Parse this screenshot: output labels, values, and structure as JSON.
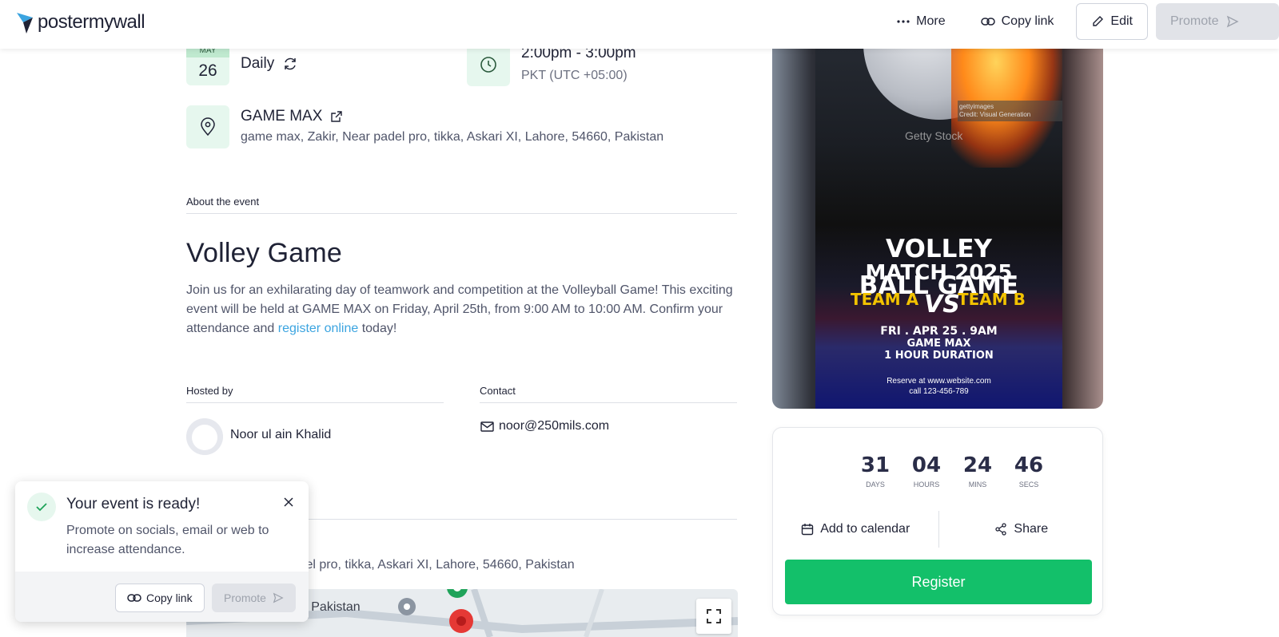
{
  "header": {
    "brand": "postermywall",
    "more_label": "More",
    "copy_link_label": "Copy link",
    "edit_label": "Edit",
    "promote_label": "Promote"
  },
  "event": {
    "month": "MAY",
    "day": "26",
    "recurrence": "Daily",
    "time": "2:00pm - 3:00pm",
    "timezone": "PKT (UTC +05:00)",
    "venue_name": "GAME MAX",
    "venue_address": "game max, Zakir, Near padel pro, tikka, Askari XI, Lahore, 54660, Pakistan",
    "about_label": "About the event",
    "title": "Volley Game",
    "description_pre": "Join us for an exhilarating day of teamwork and competition at the Volleyball Game! This exciting event will be held at GAME MAX on Friday, April 25th, from 9:00 AM to 10:00 AM. Confirm your attendance and ",
    "description_link": "register online",
    "description_post": " today!"
  },
  "host": {
    "label": "Hosted by",
    "name": "Noor ul ain Khalid"
  },
  "contact": {
    "label": "Contact",
    "email": "noor@250mils.com"
  },
  "location": {
    "address_partial": "r padel pro, tikka, Askari XI, Lahore, 54660, Pakistan",
    "map_label": "del IN Pakistan"
  },
  "toast": {
    "title": "Your event is ready!",
    "body": "Promote on socials, email or web to increase attendance.",
    "copy_link_label": "Copy link",
    "promote_label": "Promote"
  },
  "poster": {
    "getty_line1": "gettyimages",
    "getty_line2": "Credit: Visual Generation",
    "getty_mark": "Getty Stock",
    "line1": "VOLLEY",
    "line2": "MATCH 2025",
    "line3": "BALL GAME",
    "team_a": "TEAM A",
    "team_b": "TEAM B",
    "vs": "VS",
    "date": "FRI . APR 25 . 9AM",
    "venue": "GAME MAX",
    "duration": "1 HOUR DURATION",
    "reserve": "Reserve at www.website.com",
    "call": "call 123-456-789"
  },
  "countdown": {
    "days": "31",
    "days_label": "DAYS",
    "hours": "04",
    "hours_label": "HOURS",
    "mins": "24",
    "mins_label": "MINS",
    "secs": "46",
    "secs_label": "SECS"
  },
  "card": {
    "add_calendar_label": "Add to calendar",
    "share_label": "Share",
    "register_label": "Register"
  },
  "colors": {
    "accent_green": "#13c06a",
    "badge_green": "#e6f7ee",
    "link_blue": "#3ba4e0",
    "text_dark": "#1f2235"
  },
  "icons": [
    "logo-mark",
    "more-dots-icon",
    "link-icon",
    "pencil-icon",
    "send-icon",
    "refresh-icon",
    "clock-icon",
    "map-pin-icon",
    "external-link-icon",
    "mail-icon",
    "check-icon",
    "close-icon",
    "calendar-icon",
    "share-icon",
    "expand-icon"
  ]
}
